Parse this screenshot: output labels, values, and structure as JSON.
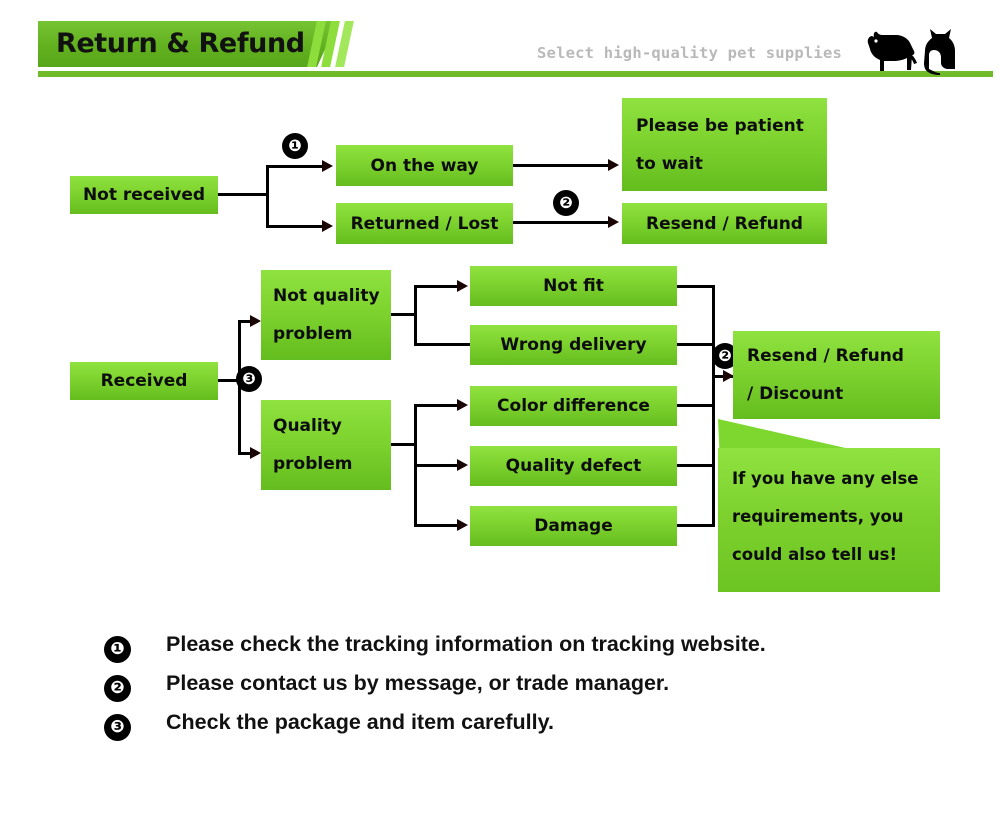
{
  "header": {
    "title": "Return & Refund",
    "tagline": "Select high-quality pet supplies",
    "accent_color": "#6fbb2a",
    "banner_color": "#62b11f",
    "tagline_color": "#b9b9b9",
    "icons": [
      "dog-silhouette",
      "cat-silhouette"
    ]
  },
  "flow": {
    "box_fill_top": "#8fe23f",
    "box_fill_bottom": "#64bd1e",
    "connector_color": "#000000",
    "not_received": {
      "label": "Not received",
      "branches": [
        {
          "label": "On the way",
          "result": "Please be patient to wait"
        },
        {
          "label": "Returned / Lost",
          "result": "Resend / Refund"
        }
      ]
    },
    "top_results": [
      {
        "line1": "Please be patient",
        "line2": "to wait"
      },
      {
        "line1": "Resend / Refund",
        "line2": ""
      }
    ],
    "received": {
      "label": "Received",
      "categories": [
        {
          "line1": "Not quality",
          "line2": "problem",
          "reasons": [
            "Not fit",
            "Wrong delivery"
          ]
        },
        {
          "line1": "Quality",
          "line2": "problem",
          "reasons": [
            "Color difference",
            "Quality defect",
            "Damage"
          ]
        }
      ]
    },
    "reasons_flat": [
      "Not fit",
      "Wrong delivery",
      "Color difference",
      "Quality defect",
      "Damage"
    ],
    "final_result": {
      "line1": "Resend / Refund",
      "line2": "/ Discount"
    },
    "bubble": {
      "line1": "If you have any else",
      "line2": "requirements, you",
      "line3": "could also tell us!"
    },
    "badges": {
      "b1": "❶",
      "b2a": "❷",
      "b3": "❸",
      "b2b": "❷"
    }
  },
  "notes": [
    {
      "num": "❶",
      "text": "Please check the tracking information on tracking website."
    },
    {
      "num": "❷",
      "text": "Please contact us by message, or trade manager."
    },
    {
      "num": "❸",
      "text": "Check the package and item carefully."
    }
  ]
}
